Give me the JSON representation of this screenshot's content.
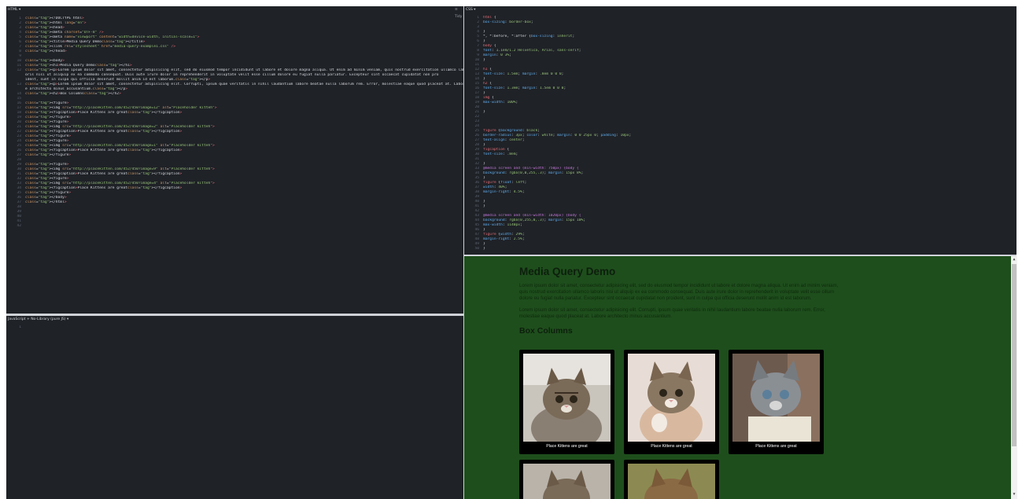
{
  "html_editor": {
    "label": "HTML ▾",
    "tidy_label": "≡ Tidy",
    "lines": [
      [
        "1",
        "<!DOCTYPE html>"
      ],
      [
        "2",
        "<html lang=\"en\">"
      ],
      [
        "3",
        "<head>"
      ],
      [
        "4",
        "<meta charset=\"UTF-8\" />"
      ],
      [
        "5",
        "<meta name=\"viewport\" content=\"width=device-width, initial-scale=1\">"
      ],
      [
        "6",
        "<title>Media Query Demo</title>"
      ],
      [
        "7",
        "<link rel=\"stylesheet\" href=\"media-query-example1.css\" />"
      ],
      [
        "8",
        "</head>"
      ],
      [
        "9",
        ""
      ],
      [
        "10",
        "<body>"
      ],
      [
        "11",
        "<h1>Media Query Demo</h1>"
      ],
      [
        "12",
        "<p>Lorem ipsum dolor sit amet, consectetur adipisicing elit, sed do eiusmod tempor incididunt ut labore et dolore magna aliqua. Ut enim ad minim veniam, quis nostrud exercitation ullamco lab"
      ],
      [
        "",
        "oris nisi ut aliquip ex ea commodo consequat. Duis aute irure dolor in reprehenderit in voluptate velit esse cillum dolore eu fugiat nulla pariatur. Excepteur sint occaecat cupidatat non pro"
      ],
      [
        "",
        "ident, sunt in culpa qui officia deserunt mollit anim id est laborum.</p>"
      ],
      [
        "13",
        "<p>Lorem ipsum dolor sit amet, consectetur adipisicing elit. Corrupti, ipsum quae veritatis in nihil laudantium labore beatae nulla laborum rem. Error, molestiae eaque quod placeat at. Labor"
      ],
      [
        "",
        "e architecto minus accusantium.</p>"
      ],
      [
        "14",
        "<h2>Box Columns</h2>"
      ],
      [
        "15",
        ""
      ],
      [
        "16",
        "<figure>"
      ],
      [
        "17",
        "<img src=\"http://placekitten.com/452/450?image=12\" alt=\"Placeholder kitteh\">"
      ],
      [
        "18",
        "<figcaption>Place Kittens are great</figcaption>"
      ],
      [
        "19",
        "</figure>"
      ],
      [
        "20",
        "<figure>"
      ],
      [
        "21",
        "<img src=\"http://placekitten.com/452/450?image=2\" alt=\"Placeholder kitteh\">"
      ],
      [
        "22",
        "<figcaption>Place Kittens are great</figcaption>"
      ],
      [
        "23",
        "</figure>"
      ],
      [
        "24",
        "<figure>"
      ],
      [
        "25",
        "<img src=\"http://placekitten.com/452/450?image=1\" alt=\"Placeholder kitteh\">"
      ],
      [
        "26",
        "<figcaption>Place Kittens are great</figcaption>"
      ],
      [
        "27",
        "</figure>"
      ],
      [
        "28",
        ""
      ],
      [
        "29",
        "<figure>"
      ],
      [
        "30",
        "<img src=\"http://placekitten.com/452/450?image=9\" alt=\"Placeholder kitteh\">"
      ],
      [
        "31",
        "<figcaption>Place Kittens are great</figcaption>"
      ],
      [
        "32",
        "<figure>"
      ],
      [
        "33",
        "<img src=\"http://placekitten.com/452/450?image=4\" alt=\"Placeholder kitteh\">"
      ],
      [
        "34",
        "<figcaption>Place Kittens are great</figcaption>"
      ],
      [
        "35",
        "</figure>"
      ],
      [
        "36",
        "</body>"
      ],
      [
        "37",
        "</html>"
      ],
      [
        "38",
        ""
      ],
      [
        "39",
        ""
      ],
      [
        "40",
        ""
      ],
      [
        "41",
        ""
      ],
      [
        "42",
        ""
      ]
    ]
  },
  "css_editor": {
    "label": "CSS ▾",
    "lines": [
      [
        "1",
        "html {"
      ],
      [
        "2",
        "box-sizing: border-box;"
      ],
      [
        "3",
        ""
      ],
      [
        "4",
        "}"
      ],
      [
        "5",
        "*, *:before, *:after {box-sizing: inherit;"
      ],
      [
        "6",
        "}"
      ],
      [
        "7",
        "body {"
      ],
      [
        "8",
        "font: 1.1em/1.2 Helvetica, Arial, sans-serif;"
      ],
      [
        "9",
        "margin: 0 3%;"
      ],
      [
        "10",
        "}"
      ],
      [
        "11",
        ""
      ],
      [
        "12",
        "h1 {"
      ],
      [
        "13",
        "font-size: 1.5em; margin: .8em 0 0 0;"
      ],
      [
        "14",
        "}"
      ],
      [
        "15",
        "h2 {"
      ],
      [
        "16",
        "font-size: 1.3em; margin: 1.5em 0 0 0;"
      ],
      [
        "17",
        "}"
      ],
      [
        "18",
        "img {"
      ],
      [
        "19",
        "max-width: 100%;"
      ],
      [
        "20",
        ""
      ],
      [
        "21",
        "}"
      ],
      [
        "22",
        ""
      ],
      [
        "23",
        ""
      ],
      [
        "24",
        ""
      ],
      [
        "25",
        "figure {background: black;"
      ],
      [
        "26",
        "border-radius: 3px; color: white; margin: 0 0 25px 0; padding: 10px;"
      ],
      [
        "27",
        "text-align: center;"
      ],
      [
        "28",
        "}"
      ],
      [
        "29",
        "figcaption {"
      ],
      [
        "30",
        "font-size: .8em;"
      ],
      [
        "31",
        ""
      ],
      [
        "32",
        "}"
      ],
      [
        "33",
        "@media screen and (min-width: 750px) {body {"
      ],
      [
        "34",
        "background: rgba(0,0,255,.3); margin: 15px 8%;"
      ],
      [
        "35",
        "}"
      ],
      [
        "36",
        "figure {float: left;"
      ],
      [
        "37",
        "width: 40%;"
      ],
      [
        "38",
        "margin-right: 4.5%;"
      ],
      [
        "39",
        ""
      ],
      [
        "40",
        "}"
      ],
      [
        "41",
        "}"
      ],
      [
        "42",
        ""
      ],
      [
        "43",
        "@media screen and (min-width: 1020px) {body {"
      ],
      [
        "44",
        "background: rgba(0,255,0,.3); margin: 15px 10%;"
      ],
      [
        "45",
        "max-width: 1140px;"
      ],
      [
        "46",
        "}"
      ],
      [
        "47",
        "figure {width: 29%;"
      ],
      [
        "48",
        "margin-right: 2.5%;"
      ],
      [
        "49",
        "}"
      ],
      [
        "50",
        "}"
      ]
    ]
  },
  "js_editor": {
    "label": "JavaScript + No-Library (pure JS) ▾",
    "lines": [
      [
        "1",
        ""
      ]
    ]
  },
  "preview": {
    "title": "Media Query Demo",
    "paragraph1": "Lorem ipsum dolor sit amet, consectetur adipisicing elit, sed do eiusmod tempor incididunt ut labore et dolore magna aliqua. Ut enim ad minim veniam, quis nostrud exercitation ullamco laboris nisi ut aliquip ex ea commodo consequat. Duis aute irure dolor in reprehenderit in voluptate velit esse cillum dolore eu fugiat nulla pariatur. Excepteur sint occaecat cupidatat non proident, sunt in culpa qui officia deserunt mollit anim id est laborum.",
    "paragraph2": "Lorem ipsum dolor sit amet, consectetur adipisicing elit. Corrupti, ipsum quae veritatis in nihil laudantium labore beatae nulla laborum rem. Error, molestiae eaque quod placeat at. Labore architecto minus accusantium.",
    "section_heading": "Box Columns",
    "figures": [
      {
        "caption": "Place Kittens are great"
      },
      {
        "caption": "Place Kittens are great"
      },
      {
        "caption": "Place Kittens are great"
      },
      {
        "caption": ""
      },
      {
        "caption": ""
      }
    ]
  },
  "colors": {
    "editor_bg": "#1f2227",
    "preview_bg": "#1e4e1c",
    "figure_bg": "#000000"
  }
}
